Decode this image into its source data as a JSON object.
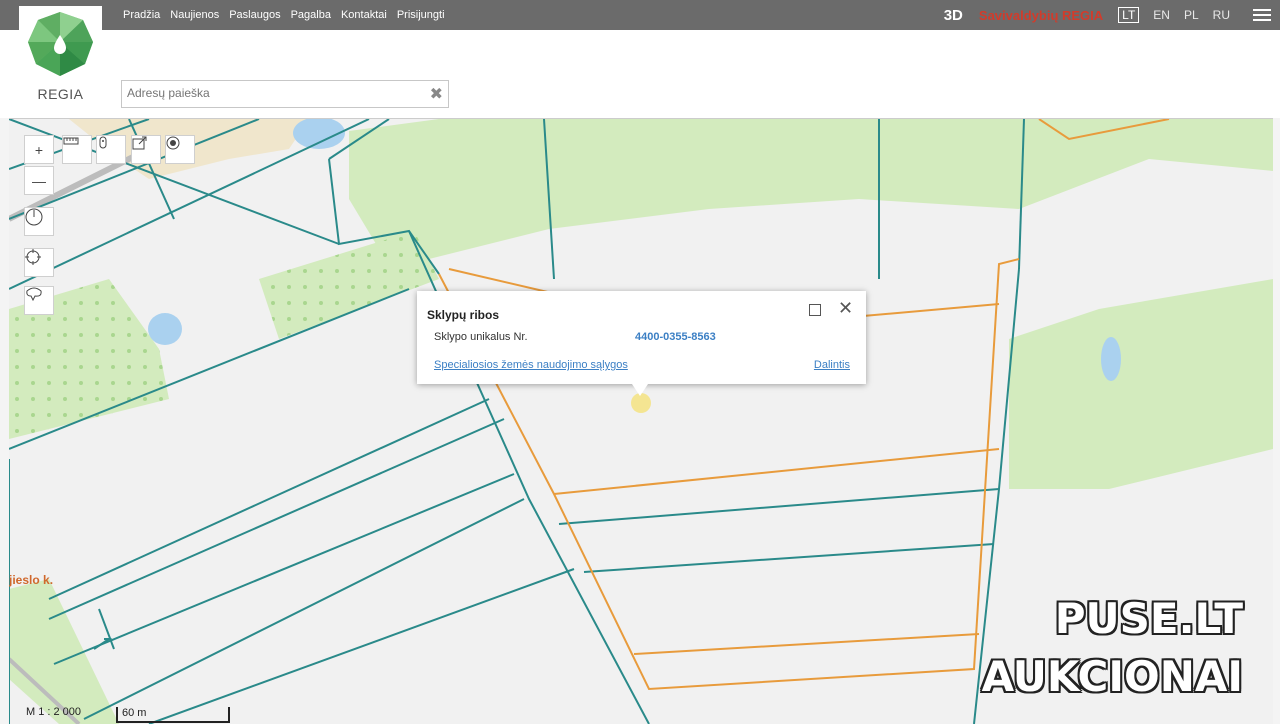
{
  "nav": {
    "items": [
      "Pradžia",
      "Naujienos",
      "Paslaugos",
      "Pagalba",
      "Kontaktai",
      "Prisijungti"
    ],
    "btn3d": "3D",
    "brand": "Savivaldybių REGIA",
    "languages": [
      "LT",
      "EN",
      "PL",
      "RU"
    ],
    "active_language": "LT"
  },
  "logo": {
    "text": "REGIA"
  },
  "search": {
    "placeholder": "Adresų paieška",
    "clear_icon": "close-icon"
  },
  "map_tools": {
    "icons": [
      "zoom-in-icon",
      "zoom-out-icon",
      "measure-ruler-icon",
      "pin-icon",
      "export-icon",
      "target-icon",
      "clock-icon",
      "locate-icon",
      "draw-polygon-icon"
    ]
  },
  "popup": {
    "title": "Sklypų ribos",
    "field_label": "Sklypo unikalus Nr.",
    "field_value": "4400-0355-8563",
    "link_special": "Specialiosios žemės naudojimo sąlygos",
    "link_share": "Dalintis"
  },
  "map": {
    "place_label": "jieslo k.",
    "scale_ratio": "M 1 : 2 000",
    "scale_distance": "60 m"
  },
  "watermark": {
    "line1": "PUSE.LT",
    "line2": "AUKCIONAI"
  },
  "colors": {
    "topbar": "#6b6b6b",
    "brand": "#d23b2b",
    "parcel_line": "#2a8a8a",
    "selected_parcel": "#e89b3c",
    "forest": "#cde8b5",
    "link": "#3b7fc4"
  }
}
